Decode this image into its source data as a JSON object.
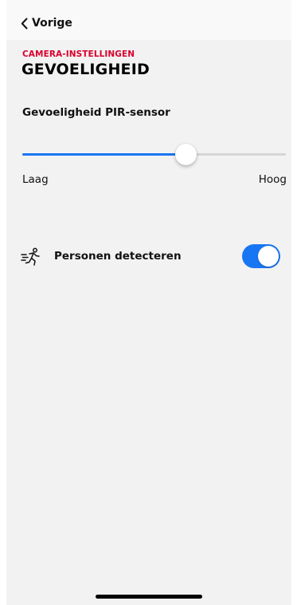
{
  "nav": {
    "back_label": "Vorige",
    "back_icon": "chevron-left-icon"
  },
  "header": {
    "section": "CAMERA-INSTELLINGEN",
    "title": "GEVOELIGHEID"
  },
  "sensitivity": {
    "title": "Gevoeligheid PIR-sensor",
    "value_fraction": 0.62,
    "low_label": "Laag",
    "high_label": "Hoog"
  },
  "person_detection": {
    "label": "Personen detecteren",
    "icon": "running-person-icon",
    "enabled": true
  },
  "colors": {
    "accent": "#1976f2",
    "section_red": "#d9002e",
    "background": "#f2f2f2"
  }
}
